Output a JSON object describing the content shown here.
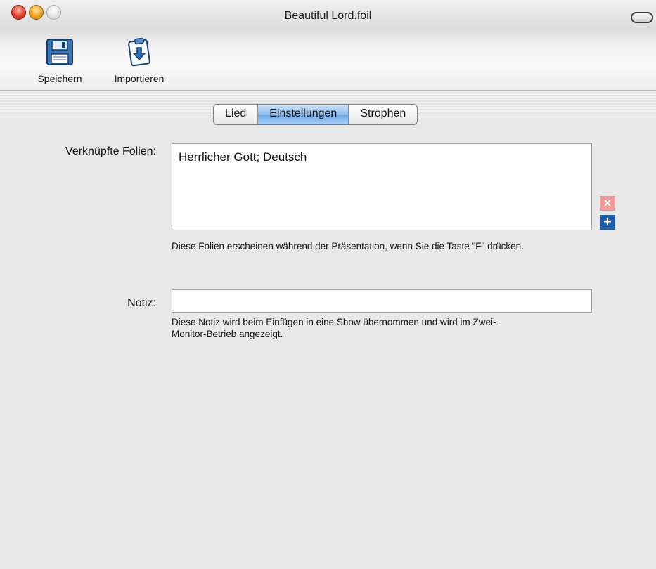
{
  "window": {
    "title": "Beautiful Lord.foil"
  },
  "toolbar": {
    "save_label": "Speichern",
    "save_icon": "floppy-disk-icon",
    "import_label": "Importieren",
    "import_icon": "clipboard-import-icon"
  },
  "tabs": [
    {
      "label": "Lied",
      "active": false
    },
    {
      "label": "Einstellungen",
      "active": true
    },
    {
      "label": "Strophen",
      "active": false
    }
  ],
  "linked_slides": {
    "label": "Verknüpfte Folien:",
    "items": [
      "Herrlicher Gott; Deutsch"
    ],
    "help": "Diese Folien erscheinen während der Präsentation, wenn Sie die Taste \"F\" drücken.",
    "remove_glyph": "×",
    "add_glyph": "+"
  },
  "note": {
    "label": "Notiz:",
    "value": "",
    "help_line1": "Diese Notiz wird beim Einfügen in eine Show übernommen und wird im Zwei-",
    "help_line2": "Monitor-Betrieb angezeigt."
  },
  "colors": {
    "active_tab": "#8fbcec",
    "remove_button": "#ef9a9a",
    "add_button": "#1e5da8"
  }
}
